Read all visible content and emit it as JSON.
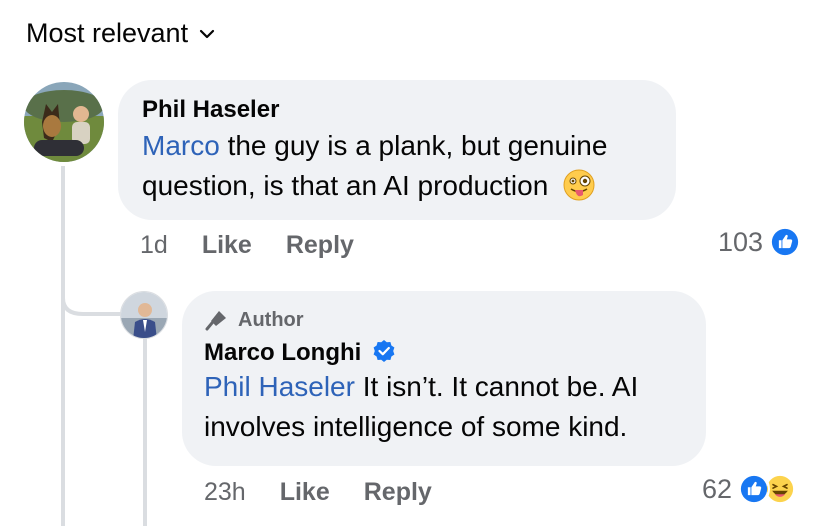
{
  "sort": {
    "label": "Most relevant",
    "icon": "chevron-down-icon"
  },
  "colors": {
    "mention": "#2e63b8",
    "bubble": "#f0f2f5",
    "like_blue": "#1877f2",
    "meta_gray": "#65676b"
  },
  "comments": [
    {
      "author": "Phil Haseler",
      "mention": "Marco",
      "text_line1": " the guy is a plank, but genuine",
      "text_line2": "question, is that an AI production",
      "emoji": "winking-face-with-tongue-icon",
      "time": "1d",
      "like_label": "Like",
      "reply_label": "Reply",
      "reaction_count": "103",
      "reactions": [
        "like-reaction-icon"
      ]
    },
    {
      "badge": "Author",
      "badge_icon": "microphone-icon",
      "author": "Marco Longhi",
      "verified": "verified-badge-icon",
      "mention": "Phil Haseler",
      "text_line1": " It isn’t. It cannot be. AI",
      "text_line2": "involves intelligence of some kind.",
      "time": "23h",
      "like_label": "Like",
      "reply_label": "Reply",
      "reaction_count": "62",
      "reactions": [
        "like-reaction-icon",
        "haha-reaction-icon"
      ]
    }
  ]
}
